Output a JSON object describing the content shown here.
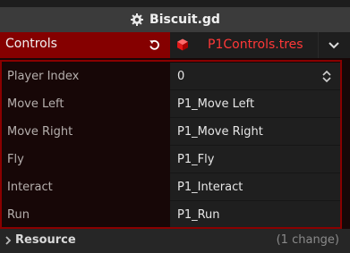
{
  "title": "Biscuit.gd",
  "section": {
    "label": "Controls",
    "resource_label": "P1Controls.tres"
  },
  "properties": [
    {
      "label": "Player Index",
      "value": "0"
    },
    {
      "label": "Move Left",
      "value": "P1_Move Left"
    },
    {
      "label": "Move Right",
      "value": "P1_Move Right"
    },
    {
      "label": "Fly",
      "value": "P1_Fly"
    },
    {
      "label": "Interact",
      "value": "P1_Interact"
    },
    {
      "label": "Run",
      "value": "P1_Run"
    }
  ],
  "footer": {
    "label": "Resource",
    "change_text": "(1 change)"
  },
  "colors": {
    "section_bg": "#850000",
    "resource_text": "#ff3838",
    "panel_border": "#8a0000"
  },
  "icons": {
    "title": "gear-icon",
    "revert": "revert-icon",
    "resource": "cube-icon",
    "dropdown": "chevron-down-icon",
    "spinner": "spin-arrows-icon",
    "footer": "chevron-right-icon"
  }
}
